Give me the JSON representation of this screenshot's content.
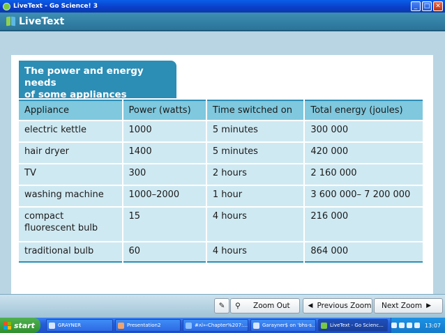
{
  "window": {
    "title": "LiveText - Go Science! 3",
    "minimize": "_",
    "maximize": "□",
    "close": "✕"
  },
  "app_header": {
    "logo_text": "LiveText"
  },
  "slide": {
    "heading_line1": "The power and energy needs",
    "heading_line2": "of some appliances",
    "columns": [
      "Appliance",
      "Power (watts)",
      "Time switched on",
      "Total energy (joules)"
    ],
    "rows": [
      [
        "electric kettle",
        "1000",
        "5 minutes",
        "300 000"
      ],
      [
        "hair dryer",
        "1400",
        "5 minutes",
        "420 000"
      ],
      [
        "TV",
        "300",
        "2 hours",
        "2 160 000"
      ],
      [
        "washing machine",
        "1000–2000",
        "1 hour",
        "3 600 000– 7 200 000"
      ],
      [
        "compact fluorescent bulb",
        "15",
        "4 hours",
        "216 000"
      ],
      [
        "traditional bulb",
        "60",
        "4 hours",
        "864 000"
      ]
    ]
  },
  "toolbar": {
    "pen_icon": "✎",
    "zoom_icon": "⚲",
    "zoom_out_label": "Zoom Out",
    "previous_zoom_label": "Previous Zoom",
    "next_zoom_label": "Next Zoom",
    "prev_arrow": "◀",
    "next_arrow": "▶"
  },
  "taskbar": {
    "start_label": "start",
    "tasks": [
      "GRAYNER",
      "Presentation2",
      "#ʌl»‹Chapter%207:...",
      "Garayner$ on 'bhs-s...",
      "LiveText - Go Scienc..."
    ],
    "clock": "13:07"
  },
  "colors": {
    "header_blue": "#2c8db5",
    "table_header": "#7fc8de",
    "table_cell": "#cfe9f2",
    "background": "#b9d5e4"
  }
}
